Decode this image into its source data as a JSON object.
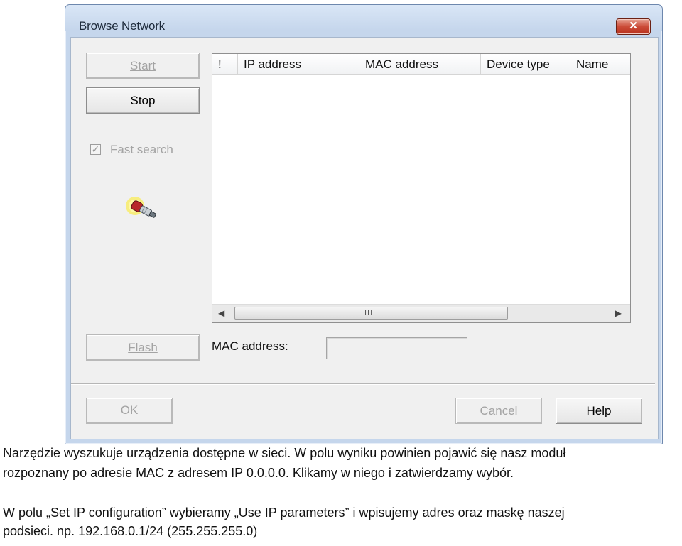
{
  "window": {
    "title": "Browse Network",
    "close_glyph": "✕"
  },
  "left_panel": {
    "start_label": "Start",
    "stop_label": "Stop",
    "fast_search_label": "Fast search",
    "fast_search_checked": true,
    "flash_label": "Flash",
    "activity_icon": "network-probe-icon"
  },
  "device_list": {
    "columns": [
      "!",
      "IP address",
      "MAC address",
      "Device type",
      "Name"
    ],
    "rows": [],
    "scroll_grip": "III"
  },
  "mac": {
    "label": "MAC address:",
    "value": ""
  },
  "footer": {
    "ok_label": "OK",
    "cancel_label": "Cancel",
    "help_label": "Help"
  },
  "caption": {
    "p1_line1": "Narzędzie wyszukuje urządzenia dostępne w sieci. W polu wyniku powinien pojawić się nasz moduł",
    "p1_line2": "rozpoznany po adresie MAC z adresem IP 0.0.0.0. Klikamy w niego i zatwierdzamy wybór.",
    "p2_line1": "W polu „Set IP configuration” wybieramy „Use IP parameters” i wpisujemy adres oraz maskę naszej",
    "p2_line2": "podsieci. np. 192.168.0.1/24 (255.255.255.0)"
  },
  "colors": {
    "title_bar": "#c5d6ec",
    "close_button": "#cb4b37",
    "disabled_text": "#a3a3a3"
  }
}
